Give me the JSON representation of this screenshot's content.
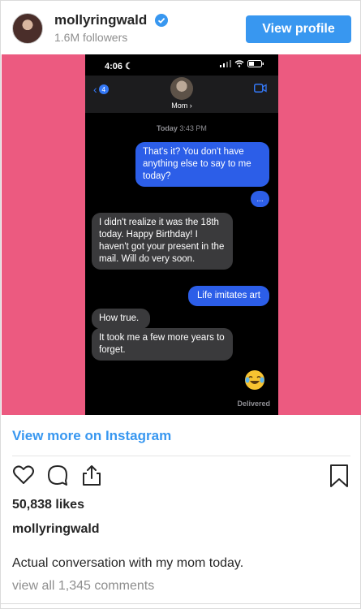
{
  "header": {
    "username": "mollyringwald",
    "verified_icon": "verified-badge-icon",
    "followers": "1.6M followers",
    "view_profile_label": "View profile"
  },
  "media": {
    "background_color": "#ec5a80",
    "phone": {
      "status_time": "4:06",
      "contact_name": "Mom",
      "timestamp_day": "Today",
      "timestamp_time": "3:43 PM",
      "back_badge": "4",
      "messages": [
        {
          "from": "me",
          "text": "That's it? You don't have anything else to say to me today?"
        },
        {
          "from": "me",
          "text": "..."
        },
        {
          "from": "mom",
          "text": "I didn't realize it was the 18th today.  Happy Birthday!  I haven't got your present in the mail.  Will do very soon."
        },
        {
          "from": "me",
          "text": "Life imitates art"
        },
        {
          "from": "mom",
          "text": "How true."
        },
        {
          "from": "mom",
          "text": "It took me a few more years to forget."
        },
        {
          "from": "me",
          "text": "😂"
        }
      ],
      "delivered": "Delivered"
    }
  },
  "footer": {
    "view_more": "View more on Instagram",
    "likes": "50,838 likes",
    "owner": "mollyringwald",
    "caption": "Actual conversation with my mom today.",
    "comments": "view all 1,345 comments"
  },
  "icons": {
    "like": "heart-icon",
    "comment": "comment-icon",
    "share": "share-icon",
    "save": "bookmark-icon"
  }
}
